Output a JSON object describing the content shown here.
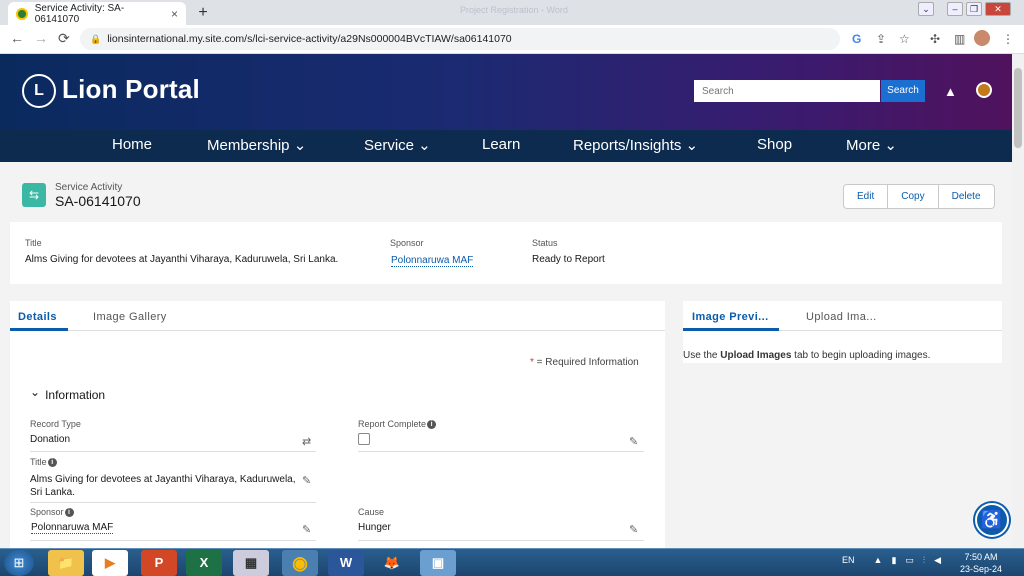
{
  "browser": {
    "tab_title": "Service Activity: SA-06141070",
    "tab_close": "×",
    "new_tab": "+",
    "window_title": "Project Registration - Word",
    "url": "lionsinternational.my.site.com/s/lci-service-activity/a29Ns000004BVcTIAW/sa06141070",
    "back": "←",
    "forward": "→",
    "reload": "⟳",
    "lock": "🔒",
    "icons": [
      "google-icon",
      "share-icon",
      "star-icon",
      "extensions-icon",
      "sidepanel-icon",
      "profile-icon",
      "menu-icon"
    ]
  },
  "header": {
    "logo": "L",
    "brand": "Lion Portal",
    "search_placeholder": "Search",
    "search_button": "Search",
    "bell": "🔔"
  },
  "nav": {
    "items": [
      "Home",
      "Membership ⌄",
      "Service ⌄",
      "Learn",
      "Reports/Insights ⌄",
      "Shop",
      "More ⌄"
    ]
  },
  "record": {
    "object_label": "Service Activity",
    "name": "SA-06141070",
    "icon": "⇆",
    "actions": [
      "Edit",
      "Copy",
      "Delete"
    ]
  },
  "highlights": {
    "title_label": "Title",
    "title_value": "Alms Giving for devotees at Jayanthi Viharaya, Kaduruwela, Sri Lanka.",
    "sponsor_label": "Sponsor",
    "sponsor_value": "Polonnaruwa MAF",
    "status_label": "Status",
    "status_value": "Ready to Report"
  },
  "tabs": {
    "left": [
      "Details",
      "Image Gallery"
    ],
    "right": [
      "Image Previ...",
      "Upload Ima..."
    ],
    "right_hint_prefix": "Use the ",
    "right_hint_bold": "Upload Images",
    "right_hint_suffix": " tab to begin uploading images."
  },
  "details": {
    "required_star": "*",
    "required_text": " = Required Information",
    "section_chevron": "⌄",
    "section_title": "Information",
    "record_type_label": "Record Type",
    "record_type_value": "Donation",
    "report_complete_label": "Report Complete",
    "title_label": "Title",
    "title_value": "Alms Giving for devotees at Jayanthi Viharaya, Kaduruwela, Sri Lanka.",
    "sponsor_label": "Sponsor",
    "sponsor_value": "Polonnaruwa MAF",
    "cause_label": "Cause",
    "cause_value": "Hunger",
    "info_glyph": "i",
    "pencil": "✎",
    "change_icon": "⇄"
  },
  "accessibility": "♿",
  "taskbar": {
    "start": "⊞",
    "apps": [
      "explorer-icon",
      "media-player-icon",
      "powerpoint-icon",
      "excel-icon",
      "calculator-icon",
      "chrome-icon",
      "word-icon",
      "firefox-icon",
      "snipping-tool-icon"
    ],
    "app_glyphs": [
      "📁",
      "▶",
      "P",
      "X",
      "▦",
      "◉",
      "W",
      "🦊",
      "▣"
    ],
    "lang": "EN",
    "time": "7:50 AM",
    "date": "23-Sep-24"
  },
  "colors": {
    "brand_blue": "#0b5cab",
    "nav_bg": "#0d2b4f",
    "record_icon": "#3bb8a4",
    "required_red": "#c23934"
  }
}
